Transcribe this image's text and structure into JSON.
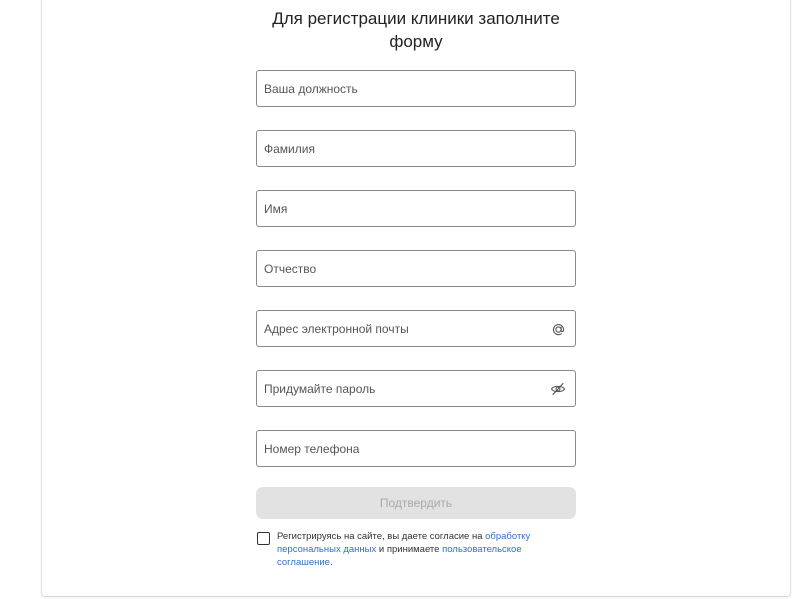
{
  "form": {
    "title": "Для регистрации клиники заполните форму",
    "fields": [
      {
        "placeholder": "Ваша должность",
        "value": ""
      },
      {
        "placeholder": "Фамилия",
        "value": ""
      },
      {
        "placeholder": "Имя",
        "value": ""
      },
      {
        "placeholder": "Отчество",
        "value": ""
      },
      {
        "placeholder": "Адрес электронной почты",
        "value": "",
        "icon": "at-icon"
      },
      {
        "placeholder": "Придумайте пароль",
        "value": "",
        "icon": "eye-off-icon"
      },
      {
        "placeholder": "Номер телефона",
        "value": ""
      }
    ],
    "submit_label": "Подтвердить",
    "consent": {
      "checked": false,
      "text_before": "Регистрируясь на сайте, вы даете согласие на ",
      "link1": "обработку персональных данных",
      "text_middle": " и принимаете ",
      "link2": "пользовательское соглашение",
      "text_after": "."
    }
  },
  "colors": {
    "link": "#2f6fd6",
    "button_bg": "#e2e2e2",
    "button_text": "#a9a9a9",
    "field_border": "#8a8a8a"
  }
}
